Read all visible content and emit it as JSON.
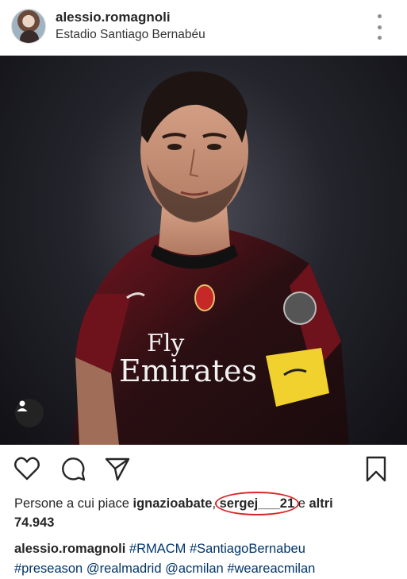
{
  "post": {
    "username": "alessio.romagnoli",
    "location": "Estadio Santiago Bernabéu"
  },
  "photo": {
    "jersey_sponsor_line1": "Fly",
    "jersey_sponsor_line2": "Emirates"
  },
  "likes": {
    "prefix": "Persone a cui piace ",
    "user1": "ignazioabate",
    "separator": ", ",
    "user2": "sergej___21",
    "joiner": " e ",
    "others_label": "altri",
    "others_count": "74.943"
  },
  "caption": {
    "author": "alessio.romagnoli",
    "hashtags": [
      "#RMACM",
      "#SantiagoBernabeu",
      "#preseason",
      "@realmadrid",
      "@acmilan",
      "#weareacmilan"
    ]
  },
  "colors": {
    "highlight_circle": "#d62828",
    "text": "#262626",
    "tag": "#003569"
  },
  "icons": [
    "more-vertical-icon",
    "user-tag-icon",
    "heart-icon",
    "comment-icon",
    "share-icon",
    "bookmark-icon"
  ]
}
